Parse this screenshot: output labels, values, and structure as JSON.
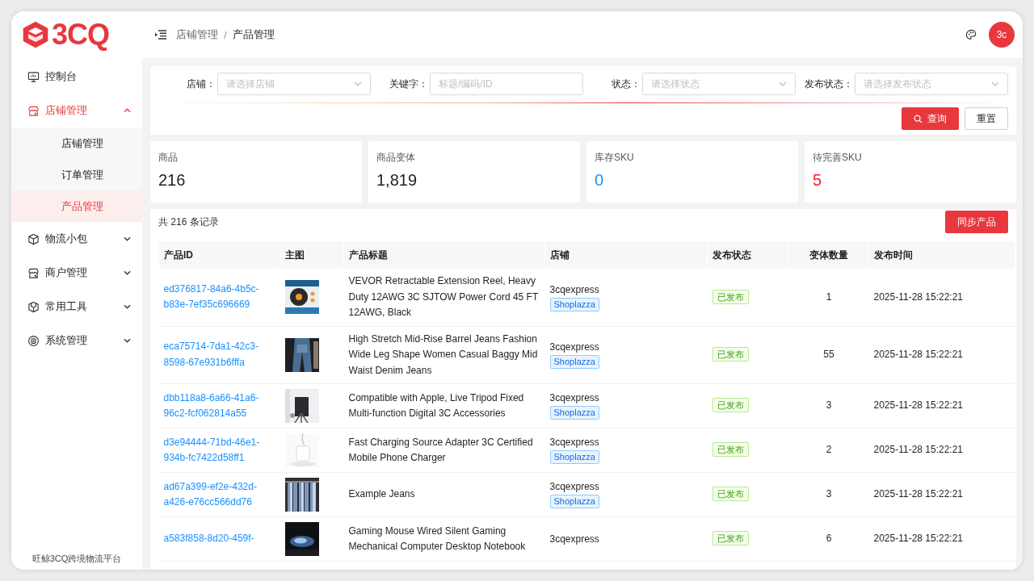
{
  "logo": {
    "text": "3CQ"
  },
  "breadcrumb": {
    "separator": "/",
    "items": [
      {
        "label": "店铺管理",
        "current": false
      },
      {
        "label": "产品管理",
        "current": true
      }
    ]
  },
  "avatar": {
    "initials": "3c"
  },
  "sidebar": {
    "items": [
      {
        "label": "控制台",
        "kind": "link",
        "selected": false
      },
      {
        "label": "店铺管理",
        "kind": "group",
        "selected": true,
        "expanded": true,
        "children": [
          {
            "label": "店铺管理",
            "selected": false
          },
          {
            "label": "订单管理",
            "selected": false
          },
          {
            "label": "产品管理",
            "selected": true
          }
        ]
      },
      {
        "label": "物流小包",
        "kind": "group",
        "selected": false,
        "expanded": false
      },
      {
        "label": "商户管理",
        "kind": "group",
        "selected": false,
        "expanded": false
      },
      {
        "label": "常用工具",
        "kind": "group",
        "selected": false,
        "expanded": false
      },
      {
        "label": "系统管理",
        "kind": "group",
        "selected": false,
        "expanded": false
      }
    ],
    "footer": "旺鲸3CQ跨境物流平台"
  },
  "filters": [
    {
      "label": "店铺：",
      "kind": "select",
      "placeholder": "请选择店铺"
    },
    {
      "label": "关键字：",
      "kind": "input",
      "placeholder": "标题/编码/ID"
    },
    {
      "label": "状态：",
      "kind": "select",
      "placeholder": "请选择状态"
    },
    {
      "label": "发布状态：",
      "kind": "select",
      "placeholder": "请选择发布状态"
    }
  ],
  "filter_buttons": [
    {
      "label": "查询",
      "kind": "primary"
    },
    {
      "label": "重置",
      "kind": "default"
    }
  ],
  "stats": [
    {
      "label": "商品",
      "value": "216",
      "color": "#1f1f1f"
    },
    {
      "label": "商品变体",
      "value": "1,819",
      "color": "#1f1f1f"
    },
    {
      "label": "库存SKU",
      "value": "0",
      "color": "#1890ff"
    },
    {
      "label": "待完善SKU",
      "value": "5",
      "color": "#f5222d"
    }
  ],
  "table": {
    "total": "共 216 条记录",
    "action": "同步产品",
    "columns": [
      "产品ID",
      "主图",
      "产品标题",
      "店铺",
      "发布状态",
      "变体数量",
      "发布时间"
    ],
    "rows": [
      {
        "id": "ed376817-84a6-4b5c-b83e-7ef35c696669",
        "title": "VEVOR Retractable Extension Reel, Heavy Duty 12AWG 3C SJTOW Power Cord 45 FT 12AWG, Black",
        "store": "3cqexpress",
        "platform": "Shoplazza",
        "status": {
          "label": "已发布",
          "kind": "published"
        },
        "variants": "1",
        "time": "2025-11-28 15:22:21"
      },
      {
        "id": "eca75714-7da1-42c3-8598-67e931b6fffa",
        "title": "High Stretch Mid-Rise Barrel Jeans Fashion Wide Leg Shape Women Casual Baggy Mid Waist Denim Jeans",
        "store": "3cqexpress",
        "platform": "Shoplazza",
        "status": {
          "label": "已发布",
          "kind": "published"
        },
        "variants": "55",
        "time": "2025-11-28 15:22:21"
      },
      {
        "id": "dbb118a8-6a66-41a6-96c2-fcf062814a55",
        "title": "Compatible with Apple, Live Tripod Fixed Multi-function Digital 3C Accessories",
        "store": "3cqexpress",
        "platform": "Shoplazza",
        "status": {
          "label": "已发布",
          "kind": "published"
        },
        "variants": "3",
        "time": "2025-11-28 15:22:21"
      },
      {
        "id": "d3e94444-71bd-46e1-934b-fc7422d58ff1",
        "title": "Fast Charging Source Adapter 3C Certified Mobile Phone Charger",
        "store": "3cqexpress",
        "platform": "Shoplazza",
        "status": {
          "label": "已发布",
          "kind": "published"
        },
        "variants": "2",
        "time": "2025-11-28 15:22:21"
      },
      {
        "id": "ad67a399-ef2e-432d-a426-e76cc566dd76",
        "title": "Example Jeans",
        "store": "3cqexpress",
        "platform": "Shoplazza",
        "status": {
          "label": "已发布",
          "kind": "published"
        },
        "variants": "3",
        "time": "2025-11-28 15:22:21"
      },
      {
        "id": "a583f858-8d20-459f-",
        "title": "Gaming Mouse Wired Silent Gaming Mechanical Computer Desktop Notebook",
        "store": "3cqexpress",
        "status": {
          "label": "已发布",
          "kind": "published"
        },
        "variants": "6",
        "time": "2025-11-28 15:22:21"
      }
    ]
  }
}
